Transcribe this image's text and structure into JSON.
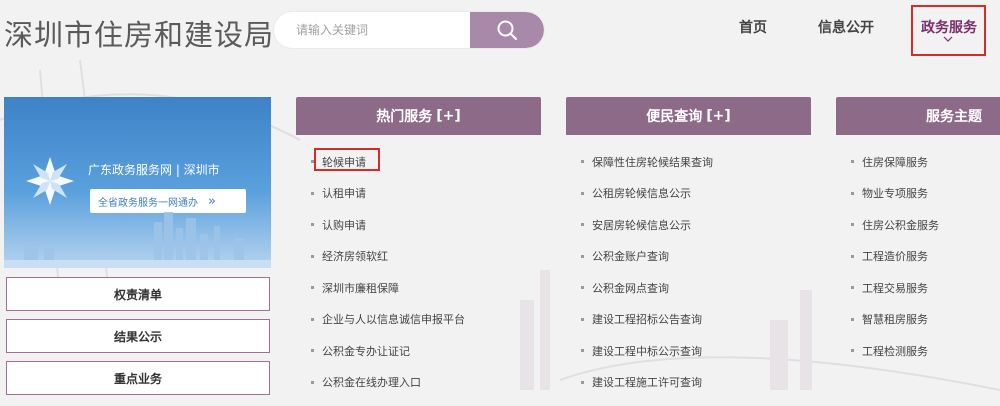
{
  "header": {
    "site_title": "深圳市住房和建设局",
    "search": {
      "placeholder": "请输入关键词"
    }
  },
  "nav": {
    "items": [
      {
        "label": "首页"
      },
      {
        "label": "信息公开"
      }
    ],
    "active": {
      "label": "政务服务"
    }
  },
  "banner": {
    "title": "广东政务服务网 | 深圳市",
    "pill_text": "全省政务服务一网通办",
    "pill_arrow": "»"
  },
  "side_buttons": [
    {
      "label": "权责清单"
    },
    {
      "label": "结果公示"
    },
    {
      "label": "重点业务"
    }
  ],
  "columns": [
    {
      "title": "热门服务",
      "more": "[+]",
      "items": [
        "轮候申请",
        "认租申请",
        "认购申请",
        "经济房领软红",
        "深圳市廉租保障",
        "企业与人以信息诚信申报平台",
        "公积金专办让证记",
        "公积金在线办理入口"
      ]
    },
    {
      "title": "便民查询",
      "more": "[+]",
      "items": [
        "保障性住房轮候结果查询",
        "公租房轮候信息公示",
        "安居房轮候信息公示",
        "公积金账户查询",
        "公积金网点查询",
        "建设工程招标公告查询",
        "建设工程中标公示查询",
        "建设工程施工许可查询"
      ]
    },
    {
      "title": "服务主题",
      "more": "",
      "items": [
        "住房保障服务",
        "物业专项服务",
        "住房公积金服务",
        "工程造价服务",
        "工程交易服务",
        "智慧租房服务",
        "工程检测服务"
      ]
    }
  ],
  "colors": {
    "accent": "#8d6a88",
    "search_button": "#a989a9",
    "highlight_border": "#d42b2b",
    "banner_blue": "#3d82c6"
  }
}
